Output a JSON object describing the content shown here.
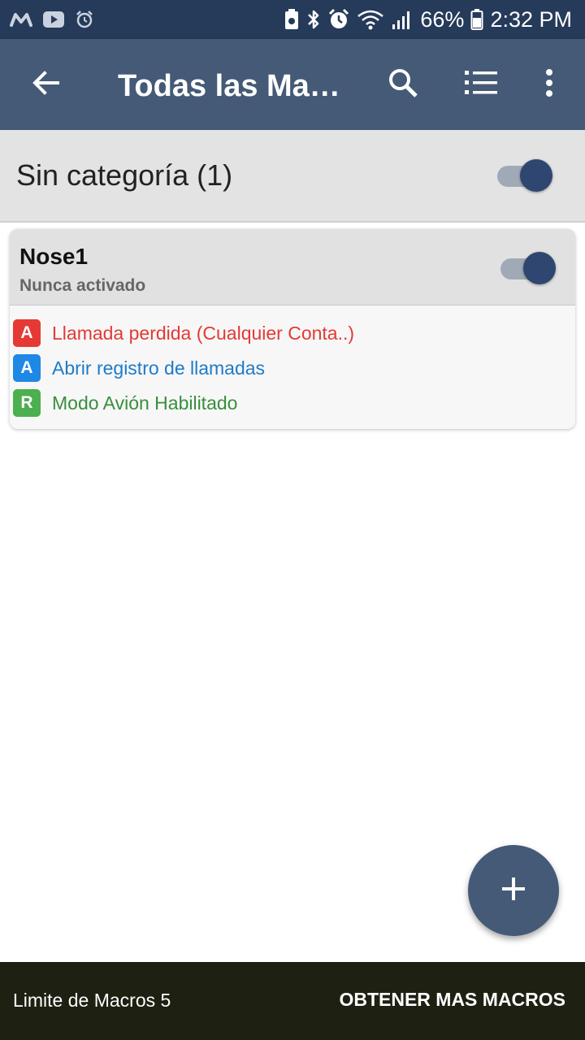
{
  "status_bar": {
    "battery_percent": "66%",
    "time": "2:32 PM",
    "icons": [
      "macrodroid-icon",
      "youtube-icon",
      "alarm-icon",
      "battery-saver-icon",
      "bluetooth-icon",
      "alarm-clock-icon",
      "wifi-icon",
      "signal-icon",
      "battery-icon"
    ]
  },
  "app_bar": {
    "title": "Todas las Ma…",
    "icons": [
      "back-arrow-icon",
      "search-icon",
      "list-icon",
      "more-vert-icon"
    ]
  },
  "category": {
    "title": "Sin categoría (1)",
    "enabled": true
  },
  "macro": {
    "name": "Nose1",
    "status": "Nunca activado",
    "enabled": true,
    "items": [
      {
        "badge": "A",
        "text": "Llamada perdida (Cualquier Conta..)",
        "badge_color": "#e53935",
        "text_color": "#e53935"
      },
      {
        "badge": "A",
        "text": "Abrir registro de llamadas",
        "badge_color": "#1e88e5",
        "text_color": "#1e7bc8"
      },
      {
        "badge": "R",
        "text": "Modo Avión Habilitado",
        "badge_color": "#4caf50",
        "text_color": "#388e3c"
      }
    ]
  },
  "fab": {
    "icon": "plus-icon"
  },
  "bottom_bar": {
    "limit_text": "Limite de Macros 5",
    "action_label": "OBTENER MAS MACROS"
  },
  "colors": {
    "status_bar": "#263a5a",
    "app_bar": "#445a76",
    "accent": "#2f4670",
    "bottom_bar": "#1e2012"
  }
}
